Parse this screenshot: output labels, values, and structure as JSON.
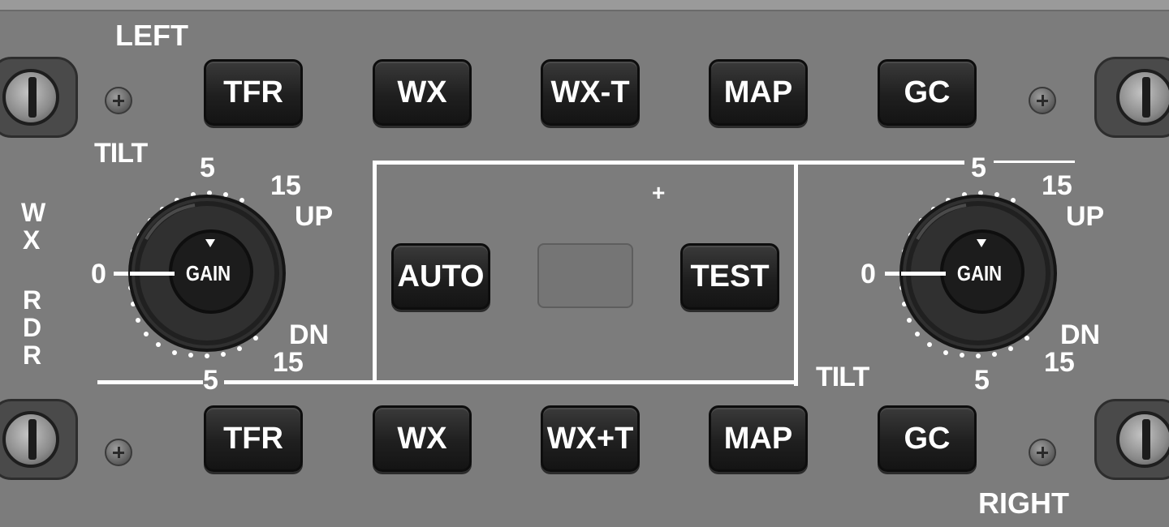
{
  "panel": {
    "left_label": "LEFT",
    "right_label": "RIGHT",
    "wx_rdr_label": [
      "W",
      "X",
      "R",
      "D",
      "R"
    ],
    "tilt_label_left": "TILT",
    "tilt_label_right": "TILT",
    "plus_marker": "+"
  },
  "top_buttons": [
    "TFR",
    "WX",
    "WX-T",
    "MAP",
    "GC"
  ],
  "bottom_buttons": [
    "TFR",
    "WX",
    "WX+T",
    "MAP",
    "GC"
  ],
  "center_buttons": {
    "auto": "AUTO",
    "test": "TEST"
  },
  "left_knob": {
    "center_label": "GAIN",
    "scale": {
      "zero": "0",
      "up5": "5",
      "up15": "15",
      "up": "UP",
      "dn": "DN",
      "dn15": "15",
      "dn5": "5"
    }
  },
  "right_knob": {
    "center_label": "GAIN",
    "scale": {
      "zero": "0",
      "up5": "5",
      "up15": "15",
      "up": "UP",
      "dn": "DN",
      "dn15": "15",
      "dn5": "5"
    }
  },
  "icons": [
    "mount-screw-icon",
    "panel-screw-icon",
    "gain-pointer-icon"
  ],
  "colors": {
    "panel": "#7c7c7c",
    "button": "#1f1f1f",
    "text": "#ffffff"
  }
}
